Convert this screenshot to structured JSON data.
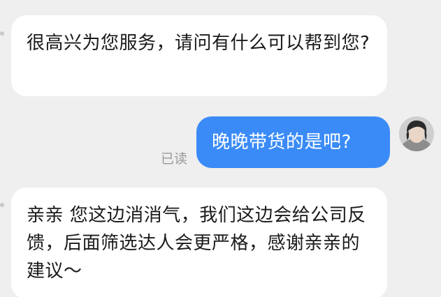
{
  "messages": [
    {
      "sender": "agent",
      "text": "很高兴为您服务，请问有什么可以帮到您?"
    },
    {
      "sender": "me",
      "text": "晚晚带货的是吧?",
      "status": "已读"
    },
    {
      "sender": "agent",
      "text": "亲亲 您这边消消气，我们这边会给公司反馈，后面筛选达人会更严格，感谢亲亲的建议～"
    }
  ],
  "colors": {
    "background": "#efefef",
    "incoming_bubble": "#ffffff",
    "outgoing_bubble": "#3a8bf8",
    "read_receipt": "#9a9a9a"
  },
  "icons": {
    "avatar": "user-avatar-photo"
  }
}
